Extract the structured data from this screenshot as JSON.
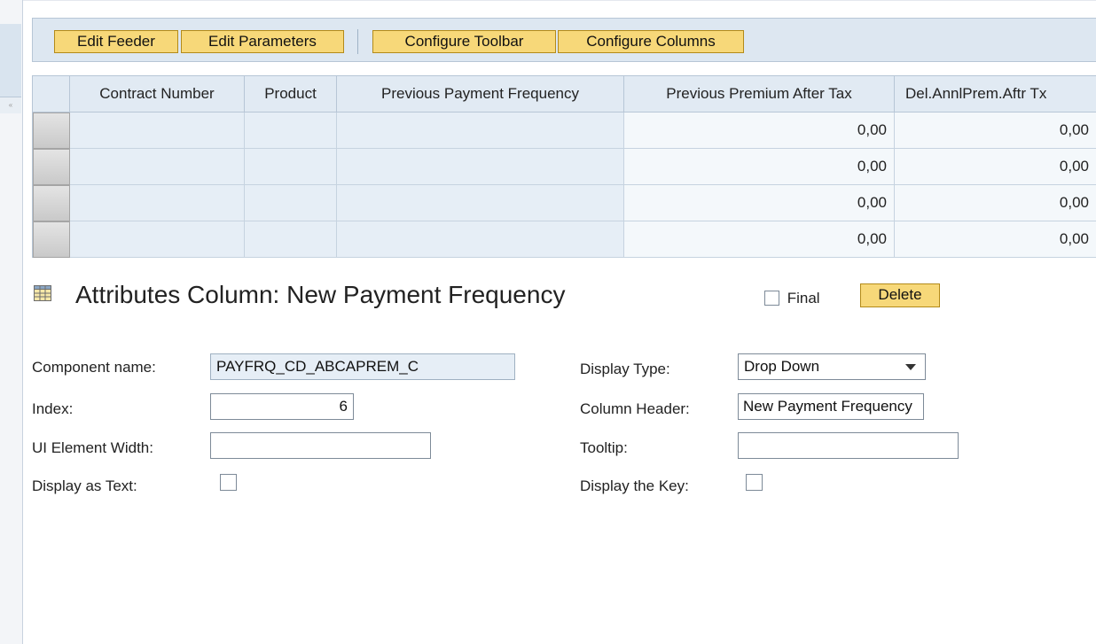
{
  "toolbar": {
    "edit_feeder": "Edit Feeder",
    "edit_parameters": "Edit Parameters",
    "configure_toolbar": "Configure Toolbar",
    "configure_columns": "Configure Columns"
  },
  "table": {
    "columns": [
      "Contract Number",
      "Product",
      "Previous Payment Frequency",
      "Previous Premium After Tax",
      "Del.AnnlPrem.Aftr Tx"
    ],
    "rows": [
      [
        "",
        "",
        "",
        "0,00",
        "0,00"
      ],
      [
        "",
        "",
        "",
        "0,00",
        "0,00"
      ],
      [
        "",
        "",
        "",
        "0,00",
        "0,00"
      ],
      [
        "",
        "",
        "",
        "0,00",
        "0,00"
      ]
    ]
  },
  "attributes": {
    "title": "Attributes Column: New Payment Frequency",
    "final_label": "Final",
    "delete_label": "Delete",
    "component_name_label": "Component name:",
    "component_name_value": "PAYFRQ_CD_ABCAPREM_C",
    "index_label": "Index:",
    "index_value": "6",
    "ui_width_label": "UI Element Width:",
    "ui_width_value": "",
    "display_as_text_label": "Display as Text:",
    "display_type_label": "Display Type:",
    "display_type_value": "Drop Down",
    "column_header_label": "Column Header:",
    "column_header_value": "New Payment Frequency",
    "tooltip_label": "Tooltip:",
    "tooltip_value": "",
    "display_key_label": "Display the Key:"
  },
  "colors": {
    "button_bg": "#f7d879",
    "toolbar_bg": "#dde7f1",
    "cell_bg": "#e6eef6"
  }
}
